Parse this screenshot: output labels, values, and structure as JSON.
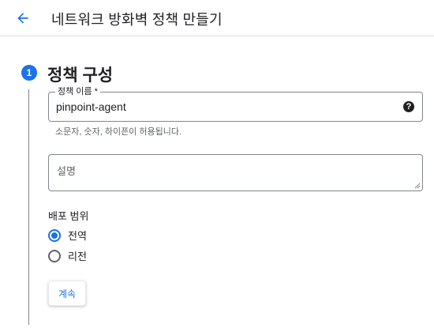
{
  "header": {
    "back_icon": "arrow-back-icon",
    "title": "네트워크 방화벽 정책 만들기"
  },
  "step": {
    "number": "1",
    "title": "정책 구성"
  },
  "form": {
    "name_field": {
      "label": "정책 이름 *",
      "value": "pinpoint-agent",
      "help_icon": "help-icon",
      "help_glyph": "?",
      "hint": "소문자, 숫자, 하이픈이 허용됩니다."
    },
    "description_field": {
      "placeholder": "설명",
      "value": ""
    },
    "scope": {
      "label": "배포 범위",
      "options": [
        {
          "label": "전역",
          "selected": true
        },
        {
          "label": "리전",
          "selected": false
        }
      ]
    },
    "continue_label": "계속"
  },
  "colors": {
    "accent": "#1a73e8",
    "text": "#202124",
    "secondary_text": "#5f6368",
    "border": "#80868b"
  }
}
